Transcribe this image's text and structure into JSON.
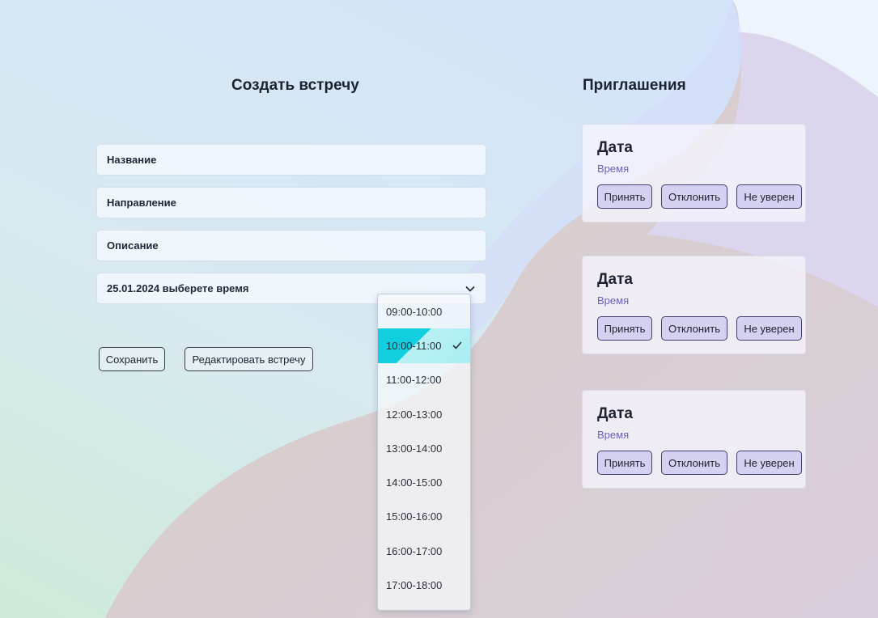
{
  "create_meeting": {
    "title": "Создать встречу",
    "fields": {
      "name_label": "Название",
      "direction_label": "Направление",
      "description_label": "Описание",
      "datetime_value": "25.01.2024 выберете время"
    },
    "time_options": [
      "09:00-10:00",
      "10:00-11:00",
      "11:00-12:00",
      "12:00-13:00",
      "13:00-14:00",
      "14:00-15:00",
      "15:00-16:00",
      "16:00-17:00",
      "17:00-18:00"
    ],
    "selected_time": "10:00-11:00",
    "save_label": "Сохранить",
    "edit_label": "Редактировать встречу"
  },
  "invitations": {
    "title": "Приглашения",
    "cards": [
      {
        "date": "Дата",
        "time": "Время",
        "accept": "Принять",
        "decline": "Отклонить",
        "unsure": "Не уверен"
      },
      {
        "date": "Дата",
        "time": "Время",
        "accept": "Принять",
        "decline": "Отклонить",
        "unsure": "Не уверен"
      },
      {
        "date": "Дата",
        "time": "Время",
        "accept": "Принять",
        "decline": "Отклонить",
        "unsure": "Не уверен"
      }
    ]
  },
  "icons": {
    "dropdown": "chevron-down-icon",
    "selected": "checkmark-icon"
  },
  "colors": {
    "selected_option": "#12cfe0",
    "invite_button": "#cdcbf0",
    "invite_time_text": "#6a63b5"
  }
}
